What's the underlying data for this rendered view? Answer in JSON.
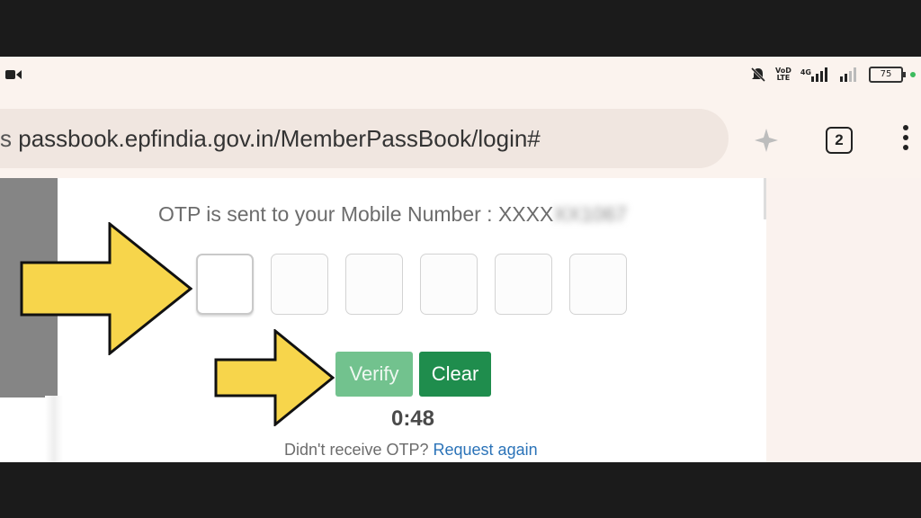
{
  "status_bar": {
    "volte_top": "VoD",
    "volte_bottom": "LTE",
    "network": "4G",
    "battery": "75"
  },
  "browser": {
    "url": "passbook.epfindia.gov.in/MemberPassBook/login#",
    "tab_count": "2"
  },
  "otp": {
    "message_prefix": "OTP is sent to your Mobile Number : XXXX",
    "masked_digits": "XX1067",
    "boxes": [
      "",
      "",
      "",
      "",
      "",
      ""
    ],
    "verify_label": "Verify",
    "clear_label": "Clear",
    "timer": "0:48",
    "resend_prompt": "Didn't receive OTP?",
    "resend_link": "Request again"
  },
  "colors": {
    "verify_button": "#72c28e",
    "clear_button": "#1f8d4d",
    "link": "#2b73b8",
    "arrow_fill": "#f7d54b"
  },
  "icons": [
    "video-camera-icon",
    "mute-bell-icon",
    "signal-icon",
    "battery-icon",
    "site-info-icon",
    "tabs-icon",
    "more-menu-icon",
    "arrow-pointer-icon"
  ]
}
